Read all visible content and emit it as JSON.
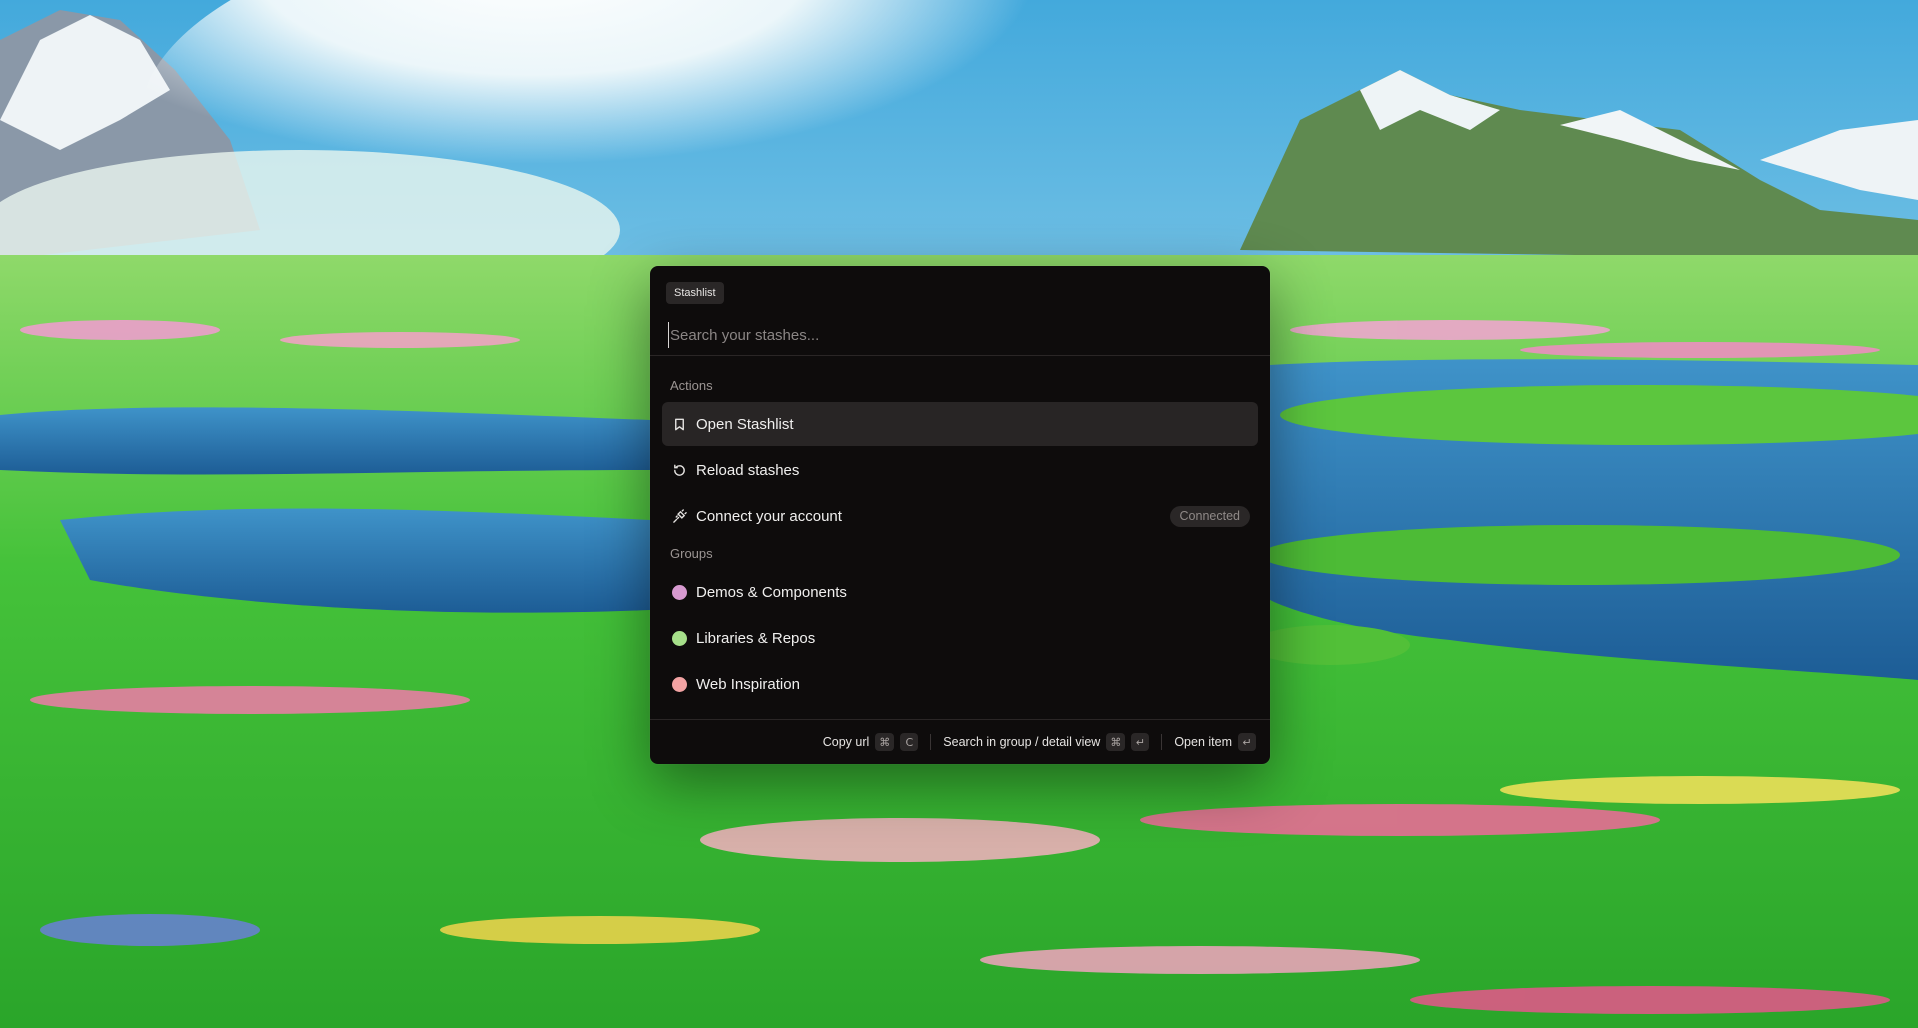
{
  "palette": {
    "app_badge": "Stashlist",
    "search": {
      "placeholder": "Search your stashes...",
      "value": ""
    },
    "sections": {
      "actions_title": "Actions",
      "groups_title": "Groups"
    },
    "actions": [
      {
        "label": "Open Stashlist",
        "icon": "bookmark-icon",
        "selected": true
      },
      {
        "label": "Reload stashes",
        "icon": "reload-icon",
        "selected": false
      },
      {
        "label": "Connect your account",
        "icon": "plug-icon",
        "selected": false,
        "badge": "Connected"
      }
    ],
    "groups": [
      {
        "label": "Demos & Components",
        "color": "#d79ad0"
      },
      {
        "label": "Libraries & Repos",
        "color": "#a6e08a"
      },
      {
        "label": "Web Inspiration",
        "color": "#f2a3a3"
      }
    ],
    "footer": {
      "copy_url": {
        "label": "Copy url",
        "keys": [
          "⌘",
          "C"
        ]
      },
      "search_group": {
        "label": "Search in group / detail view",
        "keys": [
          "⌘",
          "↵"
        ]
      },
      "open_item": {
        "label": "Open item",
        "keys": [
          "↵"
        ]
      }
    }
  },
  "colors": {
    "palette_bg": "#0e0c0c",
    "selected_row": "#282525"
  }
}
